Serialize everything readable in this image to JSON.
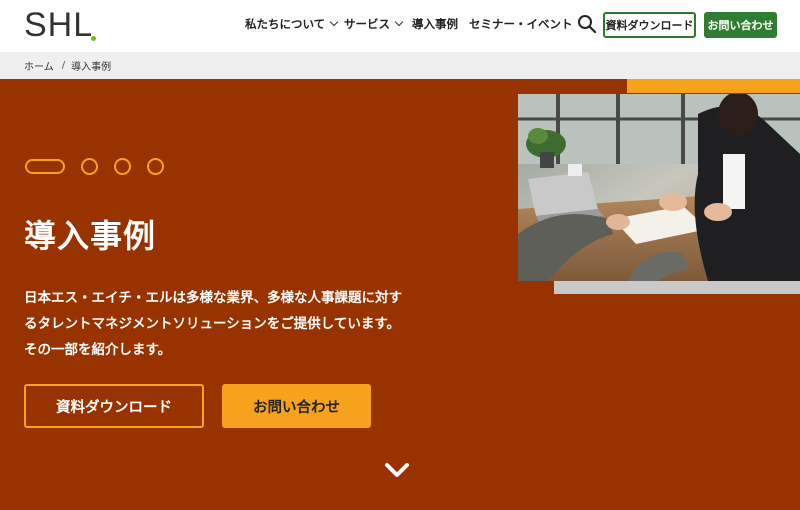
{
  "header": {
    "logo_text": "SHL",
    "nav": [
      {
        "label": "私たちについて",
        "has_dropdown": true
      },
      {
        "label": "サービス",
        "has_dropdown": true
      },
      {
        "label": "導入事例",
        "has_dropdown": false
      },
      {
        "label": "セミナー・イベント",
        "has_dropdown": false
      }
    ],
    "download_label": "資料ダウンロード",
    "contact_label": "お問い合わせ"
  },
  "breadcrumb": {
    "home": "ホーム",
    "separator": "/",
    "current": "導入事例"
  },
  "hero": {
    "title": "導入事例",
    "description": "日本エス・エイチ・エルは多様な業界、多様な人事課題に対するタレントマネジメントソリューションをご提供しています。その一部を紹介します。",
    "download_button": "資料ダウンロード",
    "contact_button": "お問い合わせ"
  },
  "colors": {
    "hero_bg": "#983300",
    "accent": "#f6a21d",
    "brand_green": "#2f7d32",
    "logo_dot": "#6cbf1f"
  },
  "icons": {
    "search": "search-icon",
    "scroll_down": "chevron-down-icon"
  }
}
